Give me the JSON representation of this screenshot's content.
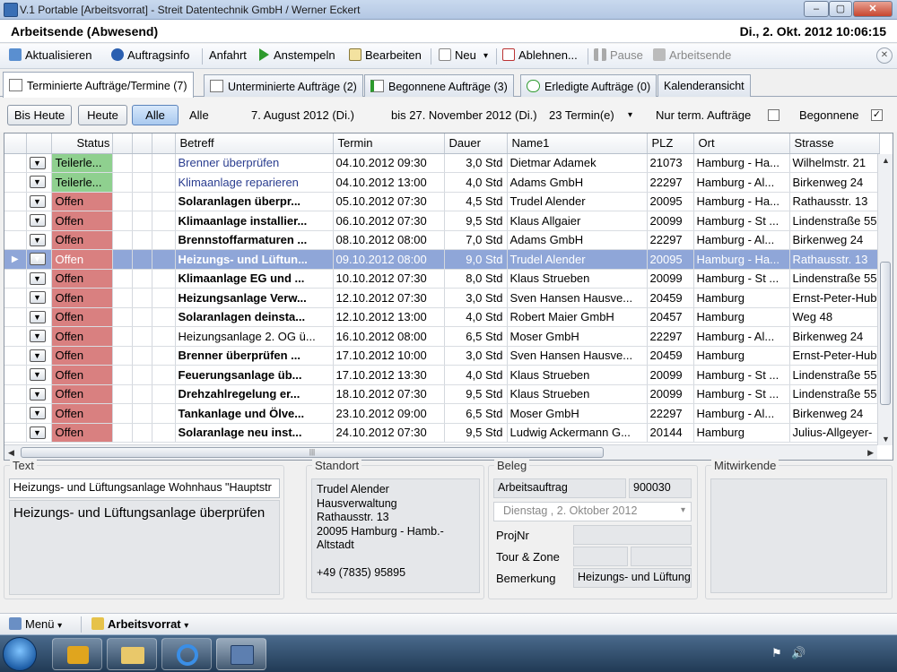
{
  "window": {
    "title": "V.1 Portable [Arbeitsvorrat] - Streit Datentechnik GmbH / Werner Eckert",
    "min": "–",
    "max": "▢",
    "close": "✕"
  },
  "status": {
    "left": "Arbeitsende (Abwesend)",
    "right": "Di., 2. Okt. 2012 10:06:15"
  },
  "toolbar": {
    "aktualisieren": "Aktualisieren",
    "auftragsinfo": "Auftragsinfo",
    "anfahrt": "Anfahrt",
    "anstempeln": "Anstempeln",
    "bearbeiten": "Bearbeiten",
    "neu": "Neu",
    "neu_arrow": "▾",
    "ablehnen": "Ablehnen...",
    "pause": "Pause",
    "arbeitsende": "Arbeitsende",
    "close": "✕"
  },
  "tabs": [
    {
      "label": "Terminierte Aufträge/Termine (7)"
    },
    {
      "label": "Unterminierte Aufträge (2)"
    },
    {
      "label": "Begonnene Aufträge (3)"
    },
    {
      "label": "Erledigte Aufträge (0)"
    },
    {
      "label": "Kalenderansicht"
    }
  ],
  "filter": {
    "bis_heute": "Bis Heute",
    "heute": "Heute",
    "alle": "Alle",
    "alle_label": "Alle",
    "date_from": "7. August 2012 (Di.)",
    "date_to": "bis 27. November 2012 (Di.)",
    "count": "23 Termin(e)",
    "count_arrow": "▾",
    "nur_term": "Nur term. Aufträge",
    "nur_term_checked": false,
    "begonnene": "Begonnene",
    "begonnene_checked": true,
    "check_mark": "✓"
  },
  "grid": {
    "columns": [
      "Status",
      "Betreff",
      "Termin",
      "Dauer",
      "Name1",
      "PLZ",
      "Ort",
      "Strasse"
    ],
    "dd_glyph": "▼",
    "row_indicator": "▶",
    "status_colors": {
      "Offen": "#d98080",
      "Teilerledigt": "#8fd08f",
      "selected": "#8fa6d8"
    },
    "rows": [
      {
        "status": "Teilerle...",
        "betreff": "Brenner überprüfen",
        "termin": "04.10.2012 09:30",
        "dauer": "3,0 Std",
        "name1": "Dietmar Adamek",
        "plz": "21073",
        "ort": "Hamburg - Ha...",
        "strasse": "Wilhelmstr. 21"
      },
      {
        "status": "Teilerle...",
        "betreff": "Klimaanlage reparieren",
        "termin": "04.10.2012 13:00",
        "dauer": "4,0 Std",
        "name1": "Adams GmbH",
        "plz": "22297",
        "ort": "Hamburg - Al...",
        "strasse": "Birkenweg 24"
      },
      {
        "status": "Offen",
        "betreff": "Solaranlagen überpr...",
        "termin": "05.10.2012 07:30",
        "dauer": "4,5 Std",
        "name1": "Trudel Alender",
        "plz": "20095",
        "ort": "Hamburg - Ha...",
        "strasse": "Rathausstr. 13"
      },
      {
        "status": "Offen",
        "betreff": "Klimaanlage installier...",
        "termin": "06.10.2012 07:30",
        "dauer": "9,5 Std",
        "name1": "Klaus Allgaier",
        "plz": "20099",
        "ort": "Hamburg - St ...",
        "strasse": "Lindenstraße 55"
      },
      {
        "status": "Offen",
        "betreff": "Brennstoffarmaturen ...",
        "termin": "08.10.2012 08:00",
        "dauer": "7,0 Std",
        "name1": "Adams GmbH",
        "plz": "22297",
        "ort": "Hamburg - Al...",
        "strasse": "Birkenweg 24"
      },
      {
        "status": "Offen",
        "betreff": "Heizungs- und Lüftun...",
        "termin": "09.10.2012 08:00",
        "dauer": "9,0 Std",
        "name1": "Trudel Alender",
        "plz": "20095",
        "ort": "Hamburg - Ha...",
        "strasse": "Rathausstr. 13"
      },
      {
        "status": "Offen",
        "betreff": "Klimaanlage EG und ...",
        "termin": "10.10.2012 07:30",
        "dauer": "8,0 Std",
        "name1": "Klaus Strueben",
        "plz": "20099",
        "ort": "Hamburg - St ...",
        "strasse": "Lindenstraße 55"
      },
      {
        "status": "Offen",
        "betreff": "Heizungsanlage Verw...",
        "termin": "12.10.2012 07:30",
        "dauer": "3,0 Std",
        "name1": "Sven Hansen Hausve...",
        "plz": "20459",
        "ort": "Hamburg",
        "strasse": "Ernst-Peter-Hub"
      },
      {
        "status": "Offen",
        "betreff": "Solaranlagen deinsta...",
        "termin": "12.10.2012 13:00",
        "dauer": "4,0 Std",
        "name1": "Robert Maier GmbH",
        "plz": "20457",
        "ort": "Hamburg",
        "strasse": "Weg 48"
      },
      {
        "status": "Offen",
        "betreff": "Heizungsanlage 2. OG ü...",
        "termin": "16.10.2012 08:00",
        "dauer": "6,5 Std",
        "name1": "Moser GmbH",
        "plz": "22297",
        "ort": "Hamburg - Al...",
        "strasse": "Birkenweg 24"
      },
      {
        "status": "Offen",
        "betreff": "Brenner überprüfen ...",
        "termin": "17.10.2012 10:00",
        "dauer": "3,0 Std",
        "name1": "Sven Hansen Hausve...",
        "plz": "20459",
        "ort": "Hamburg",
        "strasse": "Ernst-Peter-Hub"
      },
      {
        "status": "Offen",
        "betreff": "Feuerungsanlage üb...",
        "termin": "17.10.2012 13:30",
        "dauer": "4,0 Std",
        "name1": "Klaus Strueben",
        "plz": "20099",
        "ort": "Hamburg - St ...",
        "strasse": "Lindenstraße 55"
      },
      {
        "status": "Offen",
        "betreff": "Drehzahlregelung er...",
        "termin": "18.10.2012 07:30",
        "dauer": "9,5 Std",
        "name1": "Klaus Strueben",
        "plz": "20099",
        "ort": "Hamburg - St ...",
        "strasse": "Lindenstraße 55"
      },
      {
        "status": "Offen",
        "betreff": "Tankanlage und Ölve...",
        "termin": "23.10.2012 09:00",
        "dauer": "6,5 Std",
        "name1": "Moser GmbH",
        "plz": "22297",
        "ort": "Hamburg - Al...",
        "strasse": "Birkenweg 24"
      },
      {
        "status": "Offen",
        "betreff": "Solaranlage neu inst...",
        "termin": "24.10.2012 07:30",
        "dauer": "9,5 Std",
        "name1": "Ludwig Ackermann G...",
        "plz": "20144",
        "ort": "Hamburg",
        "strasse": "Julius-Allgeyer-"
      }
    ]
  },
  "scroll": {
    "left": "◀",
    "right": "▶",
    "up": "▲",
    "down": "▼",
    "grip": "|||"
  },
  "details": {
    "text_label": "Text",
    "text_short": "Heizungs- und Lüftungsanlage Wohnhaus \"Hauptstr",
    "text_body": "Heizungs- und Lüftungsanlage überprüfen",
    "standort_label": "Standort",
    "standort_lines": [
      "Trudel Alender",
      "Hausverwaltung",
      "Rathausstr. 13",
      "20095 Hamburg - Hamb.-",
      "Altstadt",
      "",
      "+49 (7835) 95895"
    ],
    "beleg_label": "Beleg",
    "beleg_type": "Arbeitsauftrag",
    "beleg_nr": "900030",
    "beleg_date": "Dienstag  ,  2.  Oktober  2012",
    "beleg_date_arrow": "▾",
    "projnr_label": "ProjNr",
    "tour_label": "Tour & Zone",
    "bemerkung_label": "Bemerkung",
    "bemerkung_value": "Heizungs- und Lüftung",
    "mitwirkende_label": "Mitwirkende"
  },
  "bottombar": {
    "menu": "Menü",
    "menu_arrow": "▾",
    "arbeitsvorrat": "Arbeitsvorrat",
    "av_arrow": "▾"
  },
  "tray": {
    "flag": "⚑",
    "speaker": "🔊"
  }
}
